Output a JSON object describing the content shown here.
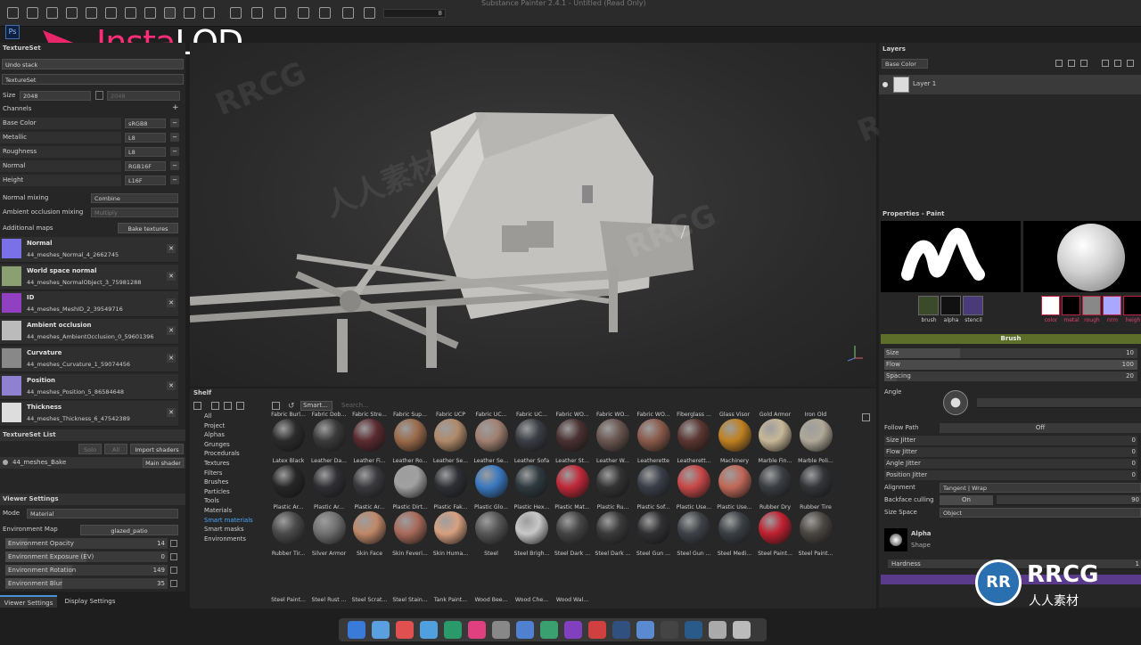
{
  "app": {
    "title": "Substance Painter 2.4.1 - Untitled (Read Only)"
  },
  "branding": {
    "logo_part1": "Insta",
    "logo_part2": "LOD",
    "watermark_top": "RRCG",
    "watermark_brand": "RRCG",
    "watermark_sub": "人人素材"
  },
  "toolbar": {
    "brush_size_value": "8"
  },
  "left": {
    "textureset_header": "TextureSet",
    "undo_stack": "Undo stack",
    "textureset_tab": "TextureSet",
    "size_label": "Size",
    "size_value": "2048",
    "size_value2": "2048",
    "channels_label": "Channels",
    "channels": [
      {
        "name": "Base Color",
        "format": "sRGB8"
      },
      {
        "name": "Metallic",
        "format": "L8"
      },
      {
        "name": "Roughness",
        "format": "L8"
      },
      {
        "name": "Normal",
        "format": "RGB16F"
      },
      {
        "name": "Height",
        "format": "L16F"
      }
    ],
    "normal_mixing_label": "Normal mixing",
    "normal_mixing_value": "Combine",
    "ao_mixing_label": "Ambient occlusion mixing",
    "ao_mixing_value": "Multiply",
    "additional_maps_label": "Additional maps",
    "bake_button": "Bake textures",
    "maps": [
      {
        "name": "Normal",
        "file": "44_meshes_Normal_4_2662745",
        "color": "#7a70e8"
      },
      {
        "name": "World space normal",
        "file": "44_meshes_NormalObject_3_75981288",
        "color": "#8aa070"
      },
      {
        "name": "ID",
        "file": "44_meshes_MeshID_2_39549716",
        "color": "#9040c0"
      },
      {
        "name": "Ambient occlusion",
        "file": "44_meshes_AmbientOcclusion_0_59601396",
        "color": "#bbbbbb"
      },
      {
        "name": "Curvature",
        "file": "44_meshes_Curvature_1_59074456",
        "color": "#888888"
      },
      {
        "name": "Position",
        "file": "44_meshes_Position_5_86584648",
        "color": "#9080d0"
      },
      {
        "name": "Thickness",
        "file": "44_meshes_Thickness_6_47542389",
        "color": "#dddddd"
      }
    ],
    "textureset_list_header": "TextureSet List",
    "solo_btn": "Solo",
    "all_btn": "All",
    "import_shaders": "Import shaders",
    "textureset_item": "44_meshes_Bake",
    "main_shader": "Main shader",
    "viewer_header": "Viewer Settings",
    "mode_label": "Mode",
    "mode_value": "Material",
    "env_map_label": "Environment Map",
    "env_map_value": "glazed_patio",
    "viewer_rows": [
      {
        "label": "Environment Opacity",
        "value": "14",
        "fill": 0.14
      },
      {
        "label": "Environment Exposure (EV)",
        "value": "0",
        "fill": 0.5
      },
      {
        "label": "Environment Rotation",
        "value": "149",
        "fill": 0.41
      },
      {
        "label": "Environment Blur",
        "value": "35",
        "fill": 0.35
      }
    ],
    "tab1": "Viewer Settings",
    "tab2": "Display Settings"
  },
  "shelf": {
    "title": "Shelf",
    "tab": "Smart...",
    "search_placeholder": "Search...",
    "categories": [
      "All",
      "Project",
      "Alphas",
      "Grunges",
      "Procedurals",
      "Textures",
      "Filters",
      "Brushes",
      "Particles",
      "Tools",
      "Materials",
      "Smart materials",
      "Smart masks",
      "Environments"
    ],
    "selected_category": "Smart materials",
    "rows": [
      [
        {
          "n": "Fabric Burl...",
          "c": "#2b2b2b"
        },
        {
          "n": "Fabric Dob...",
          "c": "#3a3a3a"
        },
        {
          "n": "Fabric Stre...",
          "c": "#5a2a30"
        },
        {
          "n": "Fabric Sup...",
          "c": "#9a6a4a"
        },
        {
          "n": "Fabric UCP",
          "c": "#b08a6a"
        },
        {
          "n": "Fabric UC...",
          "c": "#a08070"
        },
        {
          "n": "Fabric UC...",
          "c": "#3a3d44"
        },
        {
          "n": "Fabric WO...",
          "c": "#4a3030"
        },
        {
          "n": "Fabric WO...",
          "c": "#6a5550"
        },
        {
          "n": "Fabric WO...",
          "c": "#8a5a4a"
        },
        {
          "n": "Fiberglass ...",
          "c": "#5a3530"
        },
        {
          "n": "Glass Visor",
          "c": "#c08020"
        },
        {
          "n": "Gold Armor",
          "c": "#c8b898"
        },
        {
          "n": "Iron Old",
          "c": "#b0a898"
        }
      ],
      [
        {
          "n": "Latex Black",
          "c": "#262626"
        },
        {
          "n": "Leather Da...",
          "c": "#303034"
        },
        {
          "n": "Leather Fi...",
          "c": "#3a3a3e"
        },
        {
          "n": "Leather Ro...",
          "c": "#a0a0a0"
        },
        {
          "n": "Leather Se...",
          "c": "#2e3035"
        },
        {
          "n": "Leather Se...",
          "c": "#3a78c0"
        },
        {
          "n": "Leather Sofa",
          "c": "#2e3a40"
        },
        {
          "n": "Leather St...",
          "c": "#c02838"
        },
        {
          "n": "Leather W...",
          "c": "#333"
        },
        {
          "n": "Leatherette",
          "c": "#3a3e48"
        },
        {
          "n": "Leatherett...",
          "c": "#c84848"
        },
        {
          "n": "Machinery",
          "c": "#c06858"
        },
        {
          "n": "Marble Fin...",
          "c": "#3a3d42"
        },
        {
          "n": "Marble Poli...",
          "c": "#333538"
        }
      ],
      [
        {
          "n": "Plastic Ar...",
          "c": "#4a4a4a"
        },
        {
          "n": "Plastic Ar...",
          "c": "#707070"
        },
        {
          "n": "Plastic Ar...",
          "c": "#c08868"
        },
        {
          "n": "Plastic Dirt...",
          "c": "#a86a5a"
        },
        {
          "n": "Plastic Fak...",
          "c": "#d8a080"
        },
        {
          "n": "Plastic Glo...",
          "c": "#555"
        },
        {
          "n": "Plastic Hex...",
          "c": "#c8c8c8"
        },
        {
          "n": "Plastic Mat...",
          "c": "#444"
        },
        {
          "n": "Plastic Ru...",
          "c": "#3a3a3a"
        },
        {
          "n": "Plastic Sof...",
          "c": "#303033"
        },
        {
          "n": "Plastic Use...",
          "c": "#3e4248"
        },
        {
          "n": "Plastic Use...",
          "c": "#3a3f44"
        },
        {
          "n": "Rubber Dry",
          "c": "#c02030"
        },
        {
          "n": "Rubber Tire",
          "c": "#4a4642"
        }
      ],
      [
        {
          "n": "Rubber Tir...",
          "c": "#405a66"
        },
        {
          "n": "Silver Armor",
          "c": "#707070"
        },
        {
          "n": "Skin Face",
          "c": "#5a5a5a"
        },
        {
          "n": "Skin Feveri...",
          "c": "#6a6a6a"
        },
        {
          "n": "Skin Huma...",
          "c": "#7a7060"
        },
        {
          "n": "Steel",
          "c": "#a08060"
        },
        {
          "n": "Steel Brigh...",
          "c": "#7a5040"
        },
        {
          "n": "Steel Dark ...",
          "c": "#6a3a30"
        }
      ],
      [
        {
          "n": "Steel Dark ...",
          "c": ""
        },
        {
          "n": "Steel Gun ...",
          "c": ""
        },
        {
          "n": "Steel Gun ...",
          "c": ""
        },
        {
          "n": "Steel Medi...",
          "c": ""
        },
        {
          "n": "Steel Paint...",
          "c": ""
        },
        {
          "n": "Steel Paint...",
          "c": ""
        }
      ],
      [
        {
          "n": "Steel Paint...",
          "c": ""
        },
        {
          "n": "Steel Rust ...",
          "c": ""
        },
        {
          "n": "Steel Scrat...",
          "c": ""
        },
        {
          "n": "Steel Stain...",
          "c": ""
        },
        {
          "n": "Tank Paint...",
          "c": ""
        },
        {
          "n": "Wood Bee...",
          "c": ""
        },
        {
          "n": "Wood Che...",
          "c": ""
        },
        {
          "n": "Wood Wal...",
          "c": ""
        }
      ]
    ],
    "highlighted": "Steel Gun ..."
  },
  "right": {
    "layers_title": "Layers",
    "layer_channel": "Base Color",
    "layer_name": "Layer 1",
    "props_title": "Properties - Paint",
    "brush_labels": [
      "brush",
      "alpha",
      "stencil"
    ],
    "material_labels": [
      "color",
      "metal",
      "rough",
      "nrm",
      "heigh"
    ],
    "brush_section": "Brush",
    "sliders": [
      {
        "label": "Size",
        "value": "10",
        "fill": 0.3
      },
      {
        "label": "Flow",
        "value": "100",
        "fill": 1.0
      },
      {
        "label": "Spacing",
        "value": "20",
        "fill": 0.05
      }
    ],
    "angle_label": "Angle",
    "follow_path_label": "Follow Path",
    "follow_path_value": "Off",
    "jitters": [
      "Size Jitter",
      "Flow Jitter",
      "Angle Jitter",
      "Position Jitter"
    ],
    "jitter_value": "0",
    "alignment_label": "Alignment",
    "alignment_value": "Tangent | Wrap",
    "backface_label": "Backface culling",
    "backface_value": "On",
    "backface_num": "90",
    "size_space_label": "Size Space",
    "size_space_value": "Object",
    "alpha_label": "Alpha",
    "alpha_sub": "Shape",
    "hardness_label": "Hardness",
    "hardness_value": "1"
  }
}
